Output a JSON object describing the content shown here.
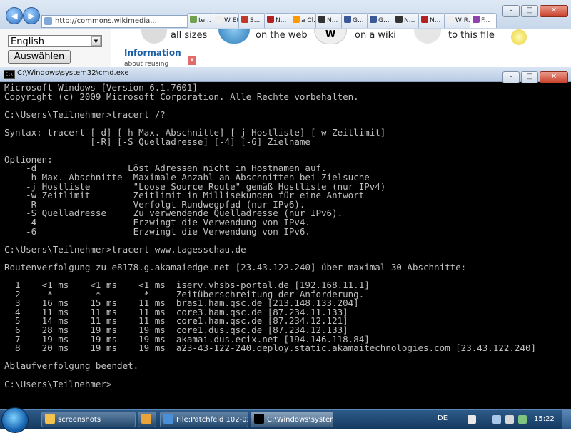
{
  "browser": {
    "url": "http://commons.wikimedia...",
    "tabs": [
      {
        "label": "te...",
        "color": "#6fa14f"
      },
      {
        "label": "W Et...",
        "color": "#eeeeee"
      },
      {
        "label": "S...",
        "color": "#c0392b"
      },
      {
        "label": "N...",
        "color": "#b22222"
      },
      {
        "label": "a Cl...",
        "color": "#ff9900"
      },
      {
        "label": "N...",
        "color": "#333333"
      },
      {
        "label": "G...",
        "color": "#3b5998"
      },
      {
        "label": "G...",
        "color": "#3b5998"
      },
      {
        "label": "N...",
        "color": "#333333"
      },
      {
        "label": "N...",
        "color": "#b22222"
      },
      {
        "label": "W R...",
        "color": "#eeeeee"
      },
      {
        "label": "F...",
        "color": "#8e44ad"
      }
    ],
    "window_controls": [
      "–",
      "□",
      "✕"
    ]
  },
  "page": {
    "language": "English",
    "choose_button": "Auswählen",
    "links": [
      "all sizes",
      "on the web",
      "on a wiki",
      "to this file"
    ],
    "info_heading": "Information",
    "info_sub": "about reusing"
  },
  "cmd": {
    "title": "C:\\Windows\\system32\\cmd.exe",
    "icon_label": "C:\\",
    "controls": [
      "–",
      "□",
      "✕"
    ],
    "lines": [
      "Microsoft Windows [Version 6.1.7601]",
      "Copyright (c) 2009 Microsoft Corporation. Alle Rechte vorbehalten.",
      "",
      "C:\\Users\\Teilnehmer>tracert /?",
      "",
      "Syntax: tracert [-d] [-h Max. Abschnitte] [-j Hostliste] [-w Zeitlimit]",
      "                [-R] [-S Quelladresse] [-4] [-6] Zielname",
      "",
      "Optionen:",
      "    -d                 Löst Adressen nicht in Hostnamen auf.",
      "    -h Max. Abschnitte  Maximale Anzahl an Abschnitten bei Zielsuche",
      "    -j Hostliste        \"Loose Source Route\" gemäß Hostliste (nur IPv4)",
      "    -w Zeitlimit        Zeitlimit in Millisekunden für eine Antwort",
      "    -R                  Verfolgt Rundwegpfad (nur IPv6).",
      "    -S Quelladresse     Zu verwendende Quelladresse (nur IPv6).",
      "    -4                  Erzwingt die Verwendung von IPv4.",
      "    -6                  Erzwingt die Verwendung von IPv6.",
      "",
      "C:\\Users\\Teilnehmer>tracert www.tagesschau.de",
      "",
      "Routenverfolgung zu e8178.g.akamaiedge.net [23.43.122.240] über maximal 30 Abschnitte:",
      "",
      "  1    <1 ms    <1 ms    <1 ms  iserv.vhsbs-portal.de [192.168.11.1]",
      "  2     *        *        *     Zeitüberschreitung der Anforderung.",
      "  3    16 ms    15 ms    11 ms  bras1.ham.qsc.de [213.148.133.204]",
      "  4    11 ms    11 ms    11 ms  core3.ham.qsc.de [87.234.11.133]",
      "  5    14 ms    11 ms    11 ms  core1.ham.qsc.de [87.234.12.121]",
      "  6    28 ms    19 ms    19 ms  core1.dus.qsc.de [87.234.12.133]",
      "  7    19 ms    19 ms    19 ms  akamai.dus.ecix.net [194.146.118.84]",
      "  8    20 ms    19 ms    19 ms  a23-43-122-240.deploy.static.akamaitechnologies.com [23.43.122.240]",
      "",
      "Ablaufverfolgung beendet.",
      "",
      "C:\\Users\\Teilnehmer>"
    ]
  },
  "taskbar": {
    "buttons": [
      {
        "label": "screenshots",
        "color": "#f2c14e"
      },
      {
        "label": "",
        "color": "#e8a33a"
      },
      {
        "label": "File:Patchfeld 102-02...",
        "color": "#4a90d9"
      },
      {
        "label": "C:\\Windows\\system...",
        "color": "#000000"
      }
    ],
    "language": "DE",
    "clock": "15:22"
  }
}
